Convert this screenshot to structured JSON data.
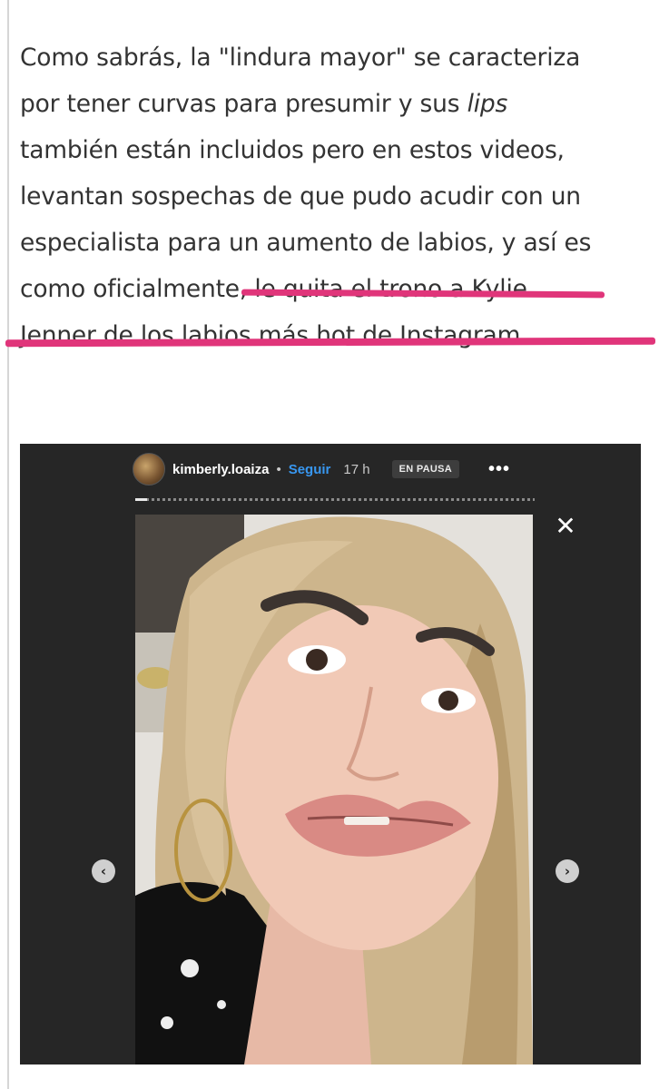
{
  "article": {
    "line1": "Como sabrás, la \"lindura mayor\" se caracteriza",
    "line2_a": "por tener curvas para presumir y sus ",
    "line2_em": "lips",
    "line3": "también están incluidos pero en estos videos,",
    "line4": "levantan sospechas de que pudo acudir con un",
    "line5": "especialista para un aumento de labios, y así es",
    "line6": "como oficialmente, le quita el trono a Kylie",
    "line7": "Jenner de los labios más hot de Instagram."
  },
  "story": {
    "username": "kimberly.loaiza",
    "separator": "•",
    "follow_label": "Seguir",
    "time": "17 h",
    "paused_label": "EN PAUSA",
    "more_label": "•••",
    "close_label": "✕",
    "prev_label": "‹",
    "next_label": "›",
    "progress": 0.03,
    "highlight_color": "#e0357a",
    "follow_color": "#3897f0"
  }
}
